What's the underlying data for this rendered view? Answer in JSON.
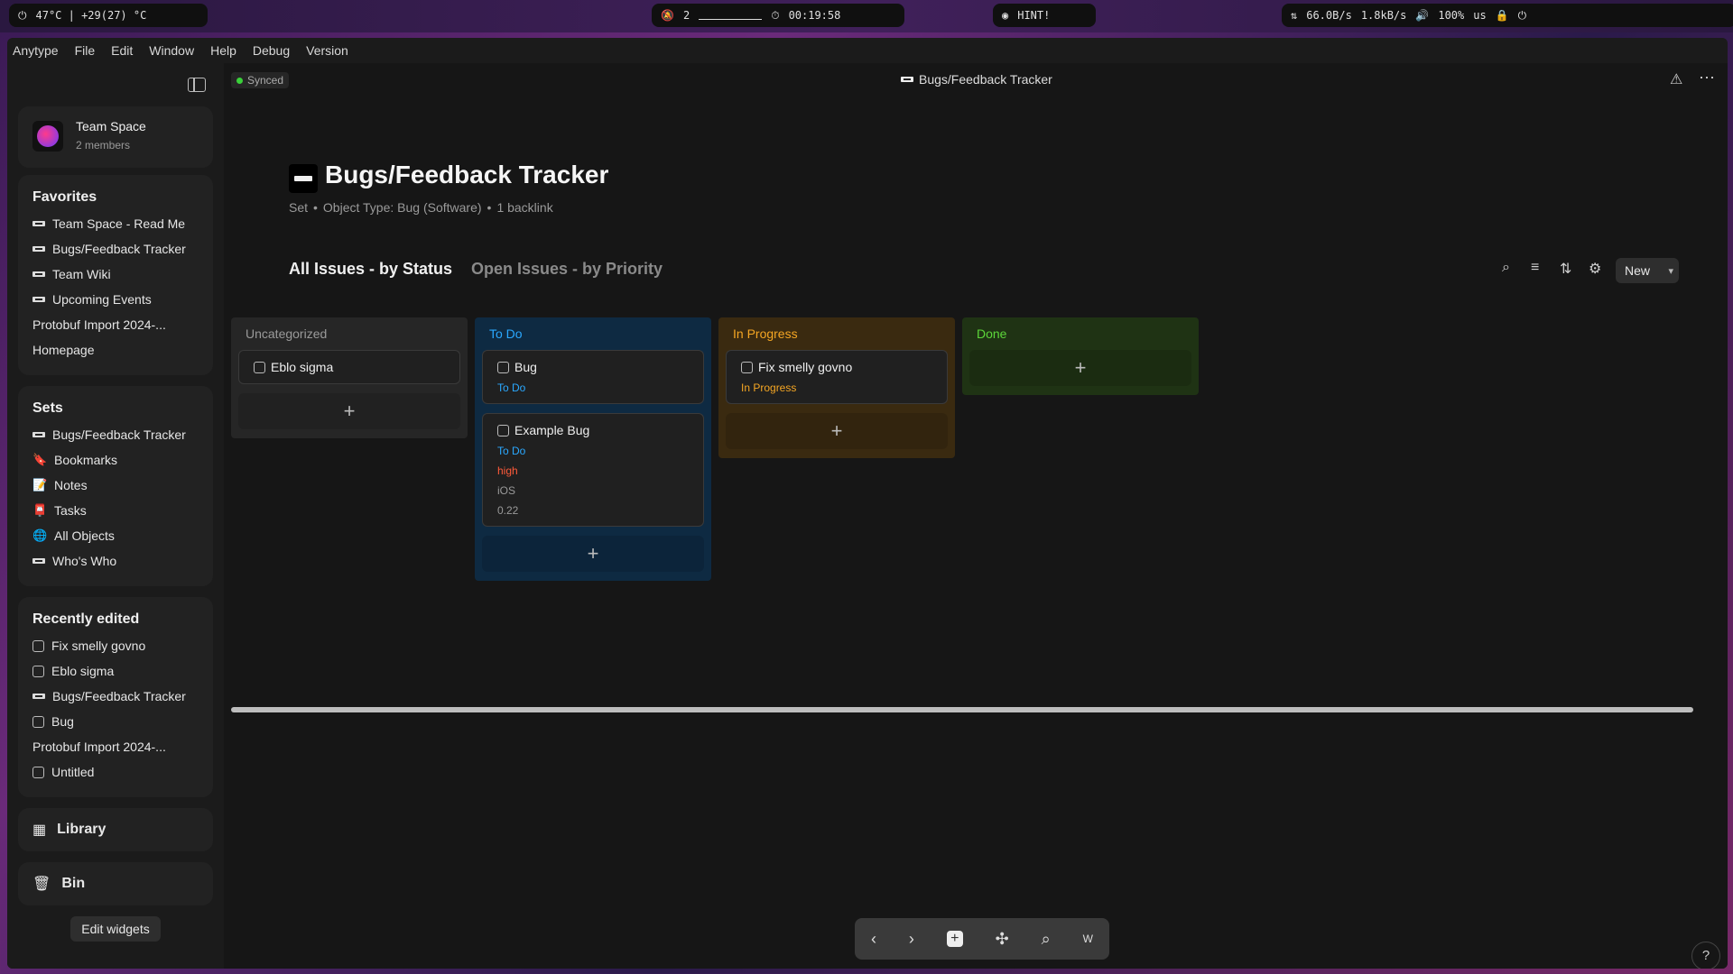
{
  "sysbar": {
    "left": "47°C  |  +29(27) °C",
    "center_count": "2",
    "timer": "00:19:58",
    "hint": "HINT!",
    "net_down": "66.0B/s",
    "net_up": "1.8kB/s",
    "volume": "100%",
    "layout": "us"
  },
  "menu": [
    "Anytype",
    "File",
    "Edit",
    "Window",
    "Help",
    "Debug",
    "Version"
  ],
  "space": {
    "name": "Team Space",
    "members": "2 members"
  },
  "favorites": {
    "title": "Favorites",
    "items": [
      {
        "label": "Team Space - Read Me",
        "icon": "flat"
      },
      {
        "label": "Bugs/Feedback Tracker",
        "icon": "flat"
      },
      {
        "label": "Team Wiki",
        "icon": "flat"
      },
      {
        "label": "Upcoming Events",
        "icon": "flat"
      },
      {
        "label": "Protobuf Import 2024-...",
        "icon": "none"
      },
      {
        "label": "Homepage",
        "icon": "none"
      }
    ]
  },
  "sets": {
    "title": "Sets",
    "items": [
      {
        "label": "Bugs/Feedback Tracker",
        "icon": "flat"
      },
      {
        "label": "Bookmarks",
        "icon": "🔖"
      },
      {
        "label": "Notes",
        "icon": "📝"
      },
      {
        "label": "Tasks",
        "icon": "📮"
      },
      {
        "label": "All Objects",
        "icon": "🌐"
      },
      {
        "label": "Who's Who",
        "icon": "flat"
      }
    ]
  },
  "recent": {
    "title": "Recently edited",
    "items": [
      {
        "label": "Fix smelly govno",
        "icon": "check"
      },
      {
        "label": "Eblo sigma",
        "icon": "check"
      },
      {
        "label": "Bugs/Feedback Tracker",
        "icon": "flat"
      },
      {
        "label": "Bug",
        "icon": "check"
      },
      {
        "label": "Protobuf Import 2024-...",
        "icon": "none"
      },
      {
        "label": "Untitled",
        "icon": "check"
      }
    ]
  },
  "library": "Library",
  "bin": "Bin",
  "edit_widgets": "Edit widgets",
  "header": {
    "status": "Synced",
    "title": "Bugs/Feedback Tracker"
  },
  "page": {
    "title": "Bugs/Feedback Tracker",
    "meta_set": "Set",
    "meta_type": "Object Type: Bug (Software)",
    "meta_backlink": "1 backlink",
    "view_active": "All Issues - by Status",
    "view_other": "Open Issues - by Priority",
    "new_button": "New"
  },
  "columns": [
    {
      "title": "Uncategorized",
      "color": "#9a9a9a",
      "bg": "#262626",
      "cards": [
        {
          "title": "Eblo sigma",
          "props": []
        }
      ]
    },
    {
      "title": "To Do",
      "color": "#2aa8ff",
      "bg": "#0e2a42",
      "cards": [
        {
          "title": "Bug",
          "props": [
            {
              "text": "To Do",
              "color": "#2aa8ff"
            }
          ]
        },
        {
          "title": "Example Bug",
          "props": [
            {
              "text": "To Do",
              "color": "#2aa8ff"
            },
            {
              "text": "high",
              "color": "#ff5a3a"
            },
            {
              "text": "iOS",
              "color": "#9a9a9a"
            },
            {
              "text": "0.22",
              "color": "#9a9a9a"
            }
          ]
        }
      ]
    },
    {
      "title": "In Progress",
      "color": "#f5a623",
      "bg": "#3a2a10",
      "cards": [
        {
          "title": "Fix smelly govno",
          "props": [
            {
              "text": "In Progress",
              "color": "#f5a623"
            }
          ]
        }
      ]
    },
    {
      "title": "Done",
      "color": "#5cd63a",
      "bg": "#1f3314",
      "cards": []
    }
  ],
  "bottom_nav": {
    "workspace_letter": "W"
  },
  "help": "?"
}
